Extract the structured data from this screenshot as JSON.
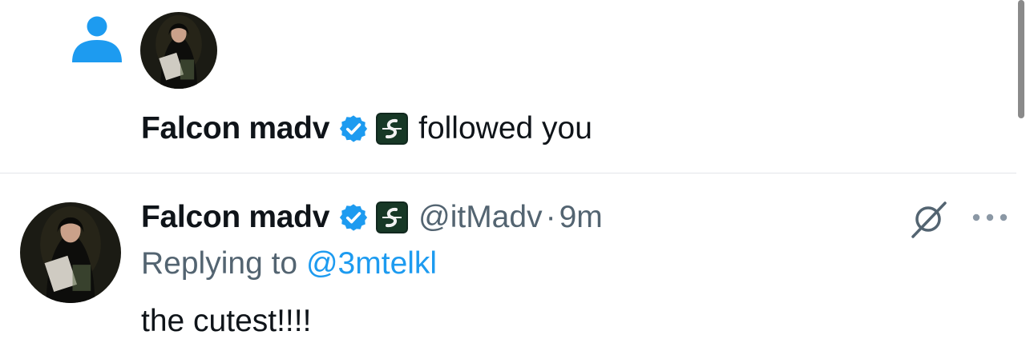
{
  "notification": {
    "type_icon": "person-icon",
    "display_name": "Falcon madv",
    "verified_icon": "verified-badge-icon",
    "affiliation_icon": "affiliate-logo-icon",
    "action_text": "followed you"
  },
  "tweet": {
    "display_name": "Falcon madv",
    "handle": "@itMadv",
    "separator": "·",
    "time": "9m",
    "replying_prefix": "Replying to",
    "replying_to": "@3mtelkl",
    "text": "the cutest!!!!",
    "grok_icon": "grok-icon",
    "more_icon": "more-dots-icon"
  },
  "colors": {
    "accent": "#1d9bf0",
    "text_primary": "#0f1419",
    "text_secondary": "#536471",
    "divider": "#e3e6e9"
  }
}
